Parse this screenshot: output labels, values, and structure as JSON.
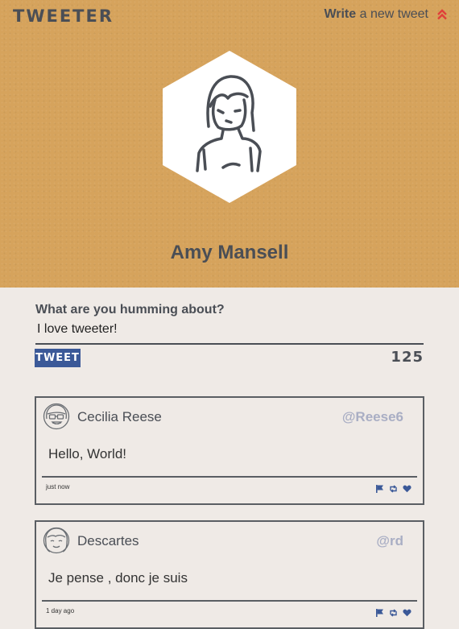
{
  "header": {
    "brand": "TWEETER",
    "write_strong": "Write",
    "write_rest": "a new tweet"
  },
  "profile": {
    "name": "Amy Mansell"
  },
  "compose": {
    "label": "What are you humming about?",
    "value": "I love tweeter!",
    "button_label": "TWEET",
    "char_count": "125"
  },
  "tweets": [
    {
      "author": "Cecilia Reese",
      "handle": "@Reese6",
      "text": "Hello, World!",
      "time": "just now"
    },
    {
      "author": "Descartes",
      "handle": "@rd",
      "text": "Je pense , donc je suis",
      "time": "1 day ago"
    }
  ],
  "icons": {
    "write": "chevrons-up-icon",
    "flag": "flag-icon",
    "retweet": "retweet-icon",
    "like": "heart-icon"
  },
  "colors": {
    "hero": "#d6a35c",
    "accent_red": "#e0403a",
    "button": "#3b5998",
    "handle": "#a9aec4",
    "text": "#4a4e55"
  }
}
